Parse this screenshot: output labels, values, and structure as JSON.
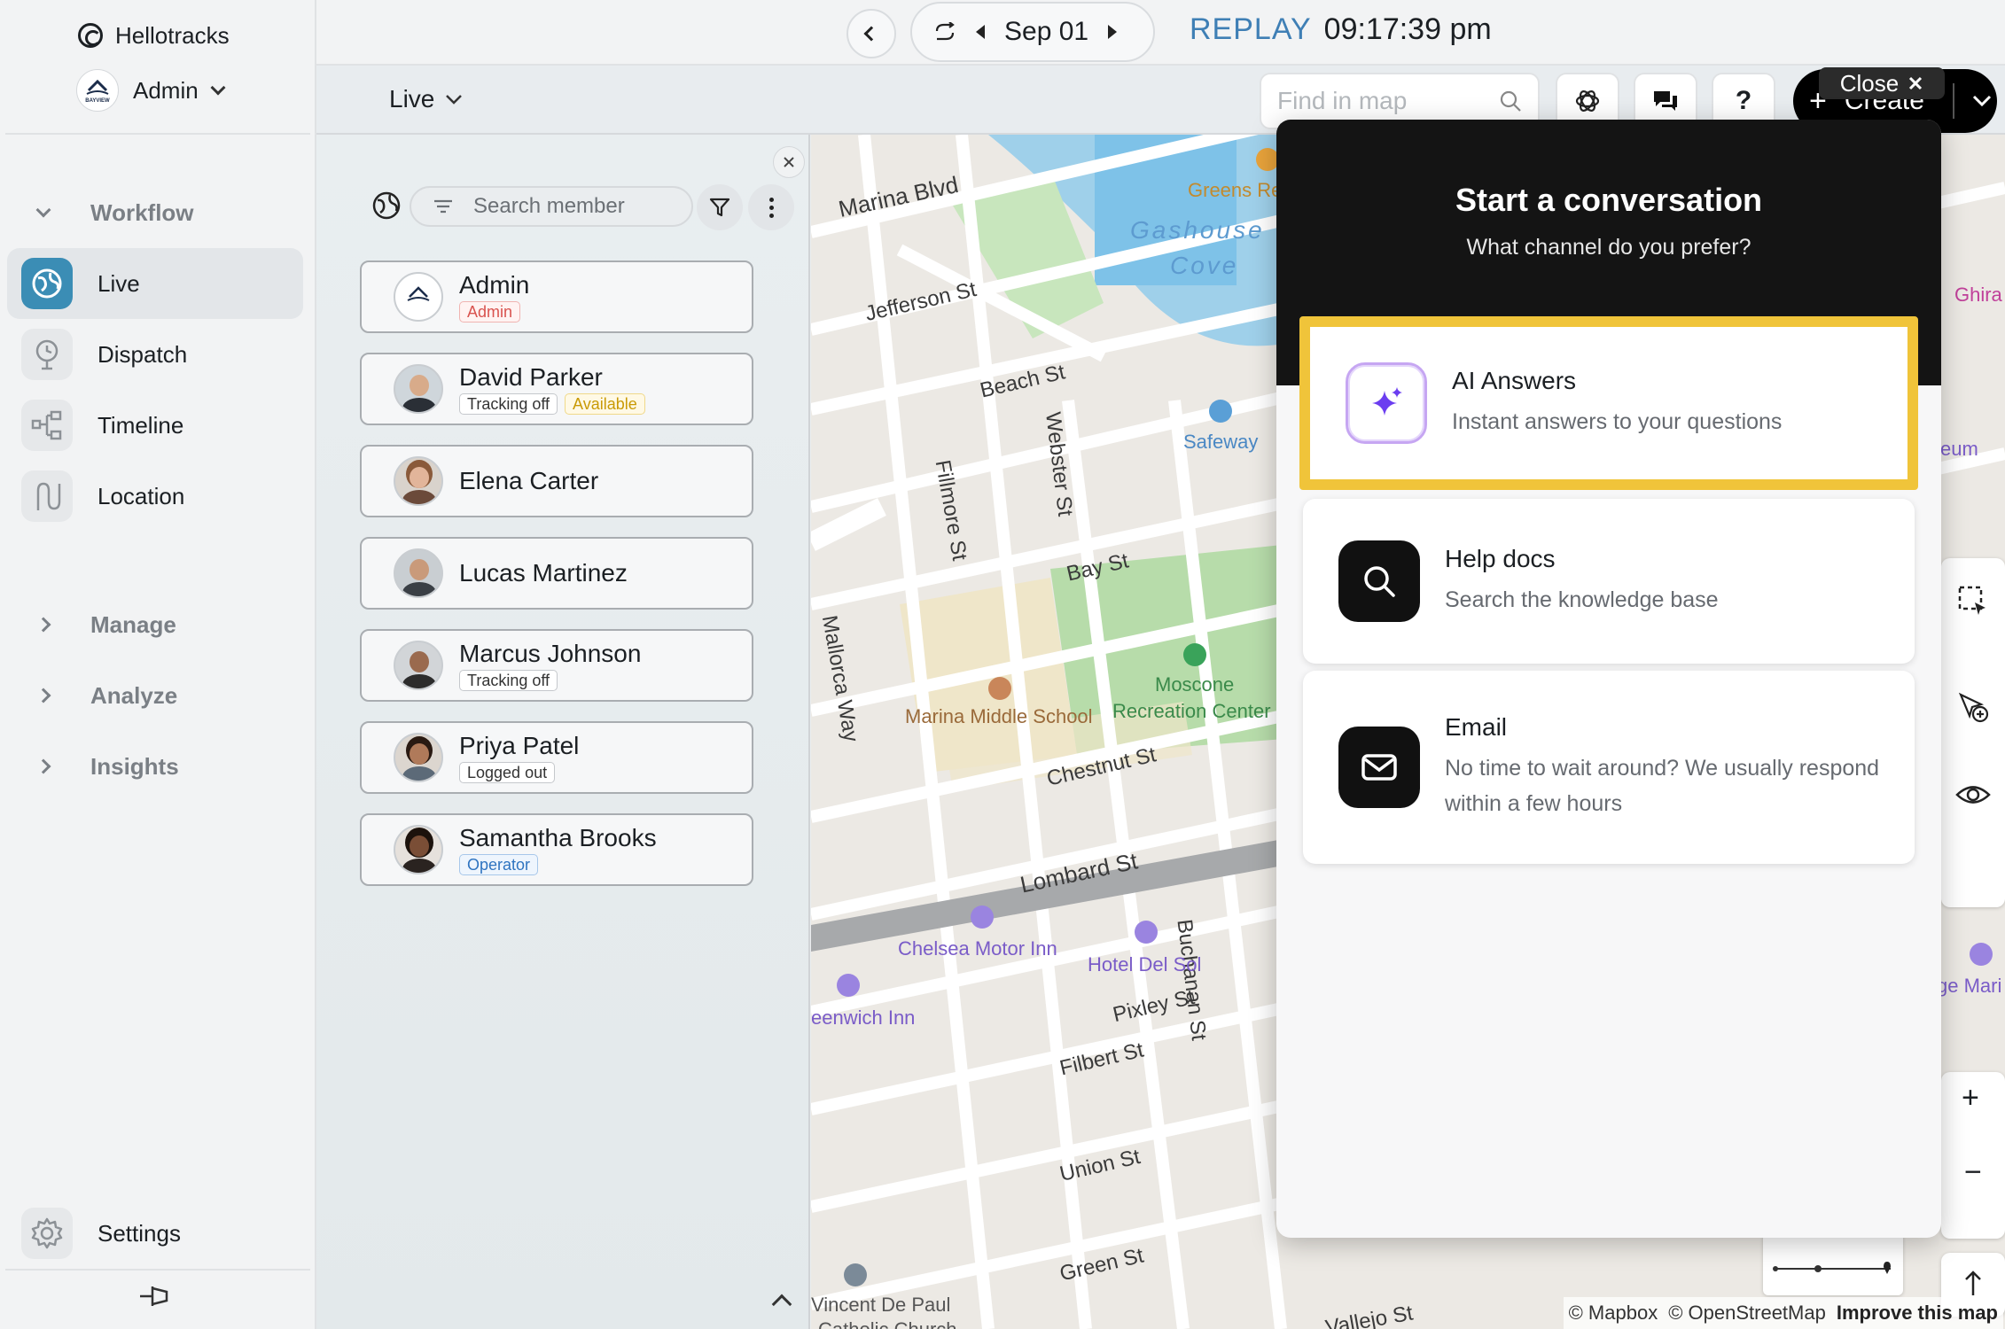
{
  "app": {
    "name": "Hellotracks",
    "account_name": "Admin",
    "account_logo_text": "BAYVIEW"
  },
  "sidebar": {
    "workflow_label": "Workflow",
    "items": [
      {
        "label": "Live",
        "icon": "globe-icon"
      },
      {
        "label": "Dispatch",
        "icon": "dispatch-icon"
      },
      {
        "label": "Timeline",
        "icon": "timeline-icon"
      },
      {
        "label": "Location",
        "icon": "route-icon"
      }
    ],
    "sections": [
      "Manage",
      "Analyze",
      "Insights"
    ],
    "settings_label": "Settings"
  },
  "topbar": {
    "date": "Sep 01",
    "replay_label": "REPLAY",
    "replay_time": "09:17:39 pm"
  },
  "subbar": {
    "view_label": "Live",
    "find_placeholder": "Find in map",
    "help_label": "?",
    "create_label": "Create",
    "close_label": "Close"
  },
  "members": {
    "search_placeholder": "Search member",
    "list": [
      {
        "name": "Admin",
        "tags": [
          {
            "text": "Admin",
            "style": "red"
          }
        ]
      },
      {
        "name": "David Parker",
        "tags": [
          {
            "text": "Tracking off",
            "style": "gray"
          },
          {
            "text": "Available",
            "style": "yellow"
          }
        ]
      },
      {
        "name": "Elena Carter",
        "tags": []
      },
      {
        "name": "Lucas Martinez",
        "tags": []
      },
      {
        "name": "Marcus Johnson",
        "tags": [
          {
            "text": "Tracking off",
            "style": "gray"
          }
        ]
      },
      {
        "name": "Priya Patel",
        "tags": [
          {
            "text": "Logged out",
            "style": "gray"
          }
        ]
      },
      {
        "name": "Samantha Brooks",
        "tags": [
          {
            "text": "Operator",
            "style": "blue"
          }
        ]
      }
    ]
  },
  "map": {
    "labels": {
      "marina": "Marina Blvd",
      "jefferson": "Jefferson St",
      "beach": "Beach St",
      "webster": "Webster St",
      "fillmore": "Fillmore St",
      "bay": "Bay St",
      "mallorca": "Mallorca Way",
      "chestnut": "Chestnut St",
      "lombard": "Lombard St",
      "buchanan": "Buchanan St",
      "pixley": "Pixley St",
      "filbert": "Filbert St",
      "union": "Union St",
      "green": "Green St",
      "vallejo": "Vallejo St",
      "safeway": "Safeway",
      "greens": "Greens Re",
      "gashouse": "Gashouse",
      "cove": "Cove",
      "moscone1": "Moscone",
      "moscone2": "Recreation Center",
      "marina_school": "Marina Middle School",
      "chelsea": "Chelsea Motor Inn",
      "hotel_del_sol": "Hotel Del Sol",
      "greenwich": "eenwich Inn",
      "vincent1": "Vincent De Paul",
      "vincent2": "Catholic Church",
      "ghira": "Ghira",
      "eum": "eum",
      "gemari": "ge Mari"
    },
    "attribution": [
      "© Mapbox",
      "© OpenStreetMap",
      "Improve this map"
    ]
  },
  "conversation": {
    "title": "Start a conversation",
    "subtitle": "What channel do you prefer?",
    "options": [
      {
        "title": "AI Answers",
        "desc": "Instant answers to your questions",
        "icon": "sparkle-icon"
      },
      {
        "title": "Help docs",
        "desc": "Search the knowledge base",
        "icon": "search-icon"
      },
      {
        "title": "Email",
        "desc": "No time to wait around? We usually respond within a few hours",
        "icon": "mail-icon"
      }
    ]
  },
  "colors": {
    "accent": "#3b8db5",
    "replay": "#3f7fb5",
    "highlight": "#f0c43a",
    "dark": "#141414"
  }
}
